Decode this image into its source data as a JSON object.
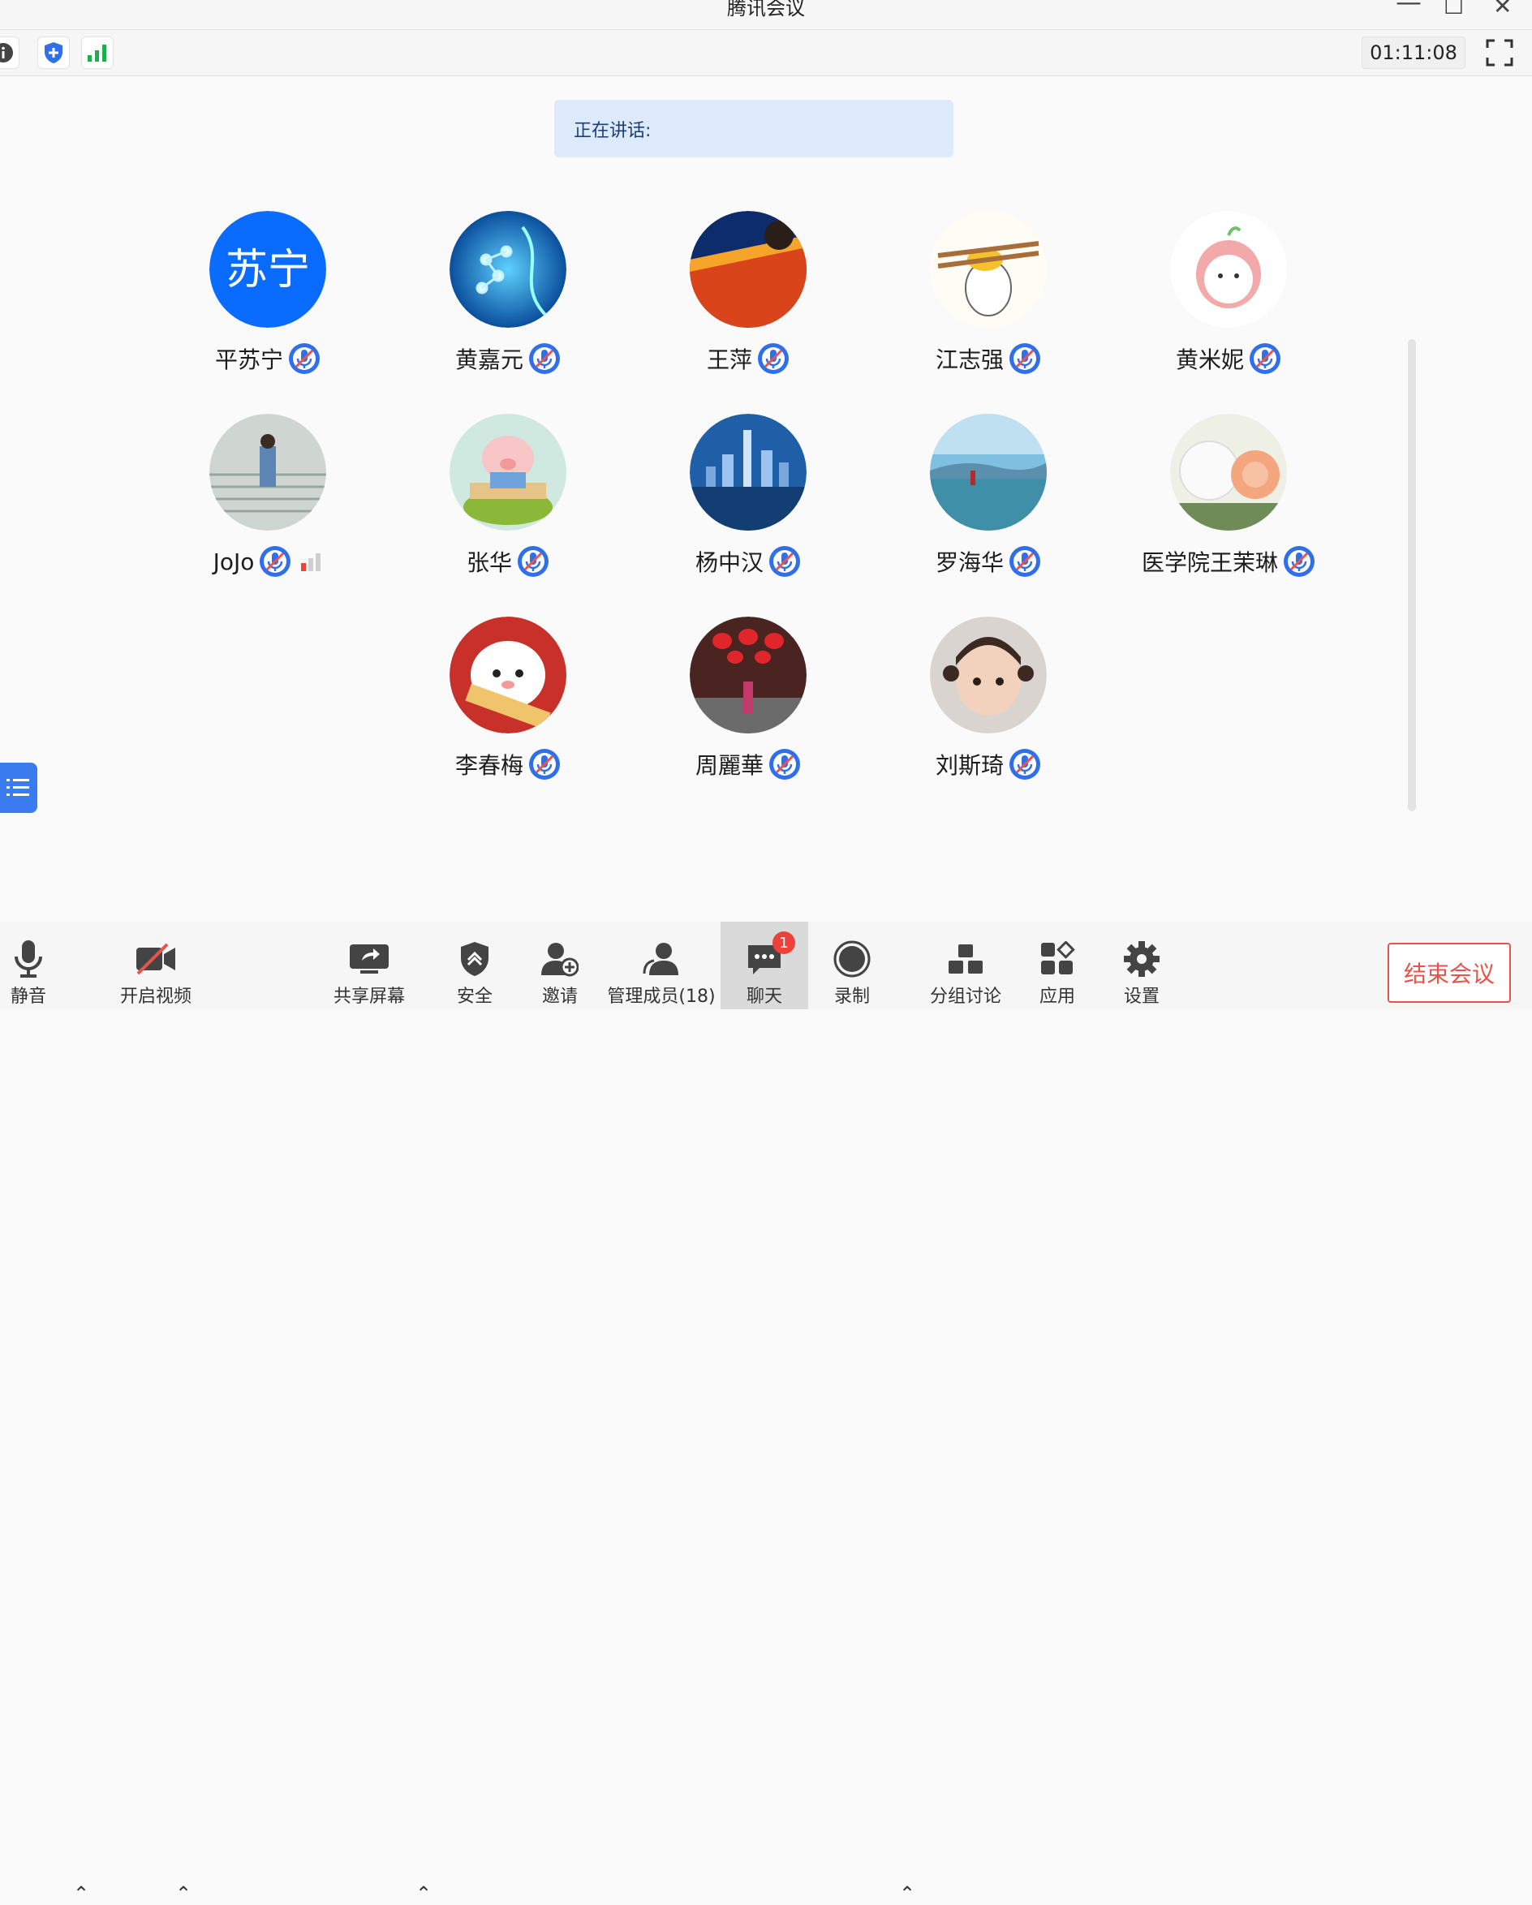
{
  "window": {
    "title": "腾讯会议"
  },
  "toolbar": {
    "timer": "01:11:08"
  },
  "speaking": {
    "label": "正在讲话:"
  },
  "participants": [
    {
      "name": "平苏宁",
      "avatar_text": "苏宁"
    },
    {
      "name": "黄嘉元"
    },
    {
      "name": "王萍"
    },
    {
      "name": "江志强"
    },
    {
      "name": "黄米妮"
    },
    {
      "name": "JoJo"
    },
    {
      "name": "张华"
    },
    {
      "name": "杨中汉"
    },
    {
      "name": "罗海华"
    },
    {
      "name": "医学院王茉琳"
    },
    {
      "name": "李春梅"
    },
    {
      "name": "周麗華"
    },
    {
      "name": "刘斯琦"
    }
  ],
  "bottombar": {
    "mute": "静音",
    "video": "开启视频",
    "share": "共享屏幕",
    "security": "安全",
    "invite": "邀请",
    "members": "管理成员(18)",
    "chat": "聊天",
    "chat_badge": "1",
    "record": "录制",
    "breakout": "分组讨论",
    "apps": "应用",
    "settings": "设置",
    "end": "结束会议"
  },
  "colors": {
    "accent": "#2f6fec",
    "end_red": "#e8544a",
    "signal_green": "#18b04a"
  }
}
